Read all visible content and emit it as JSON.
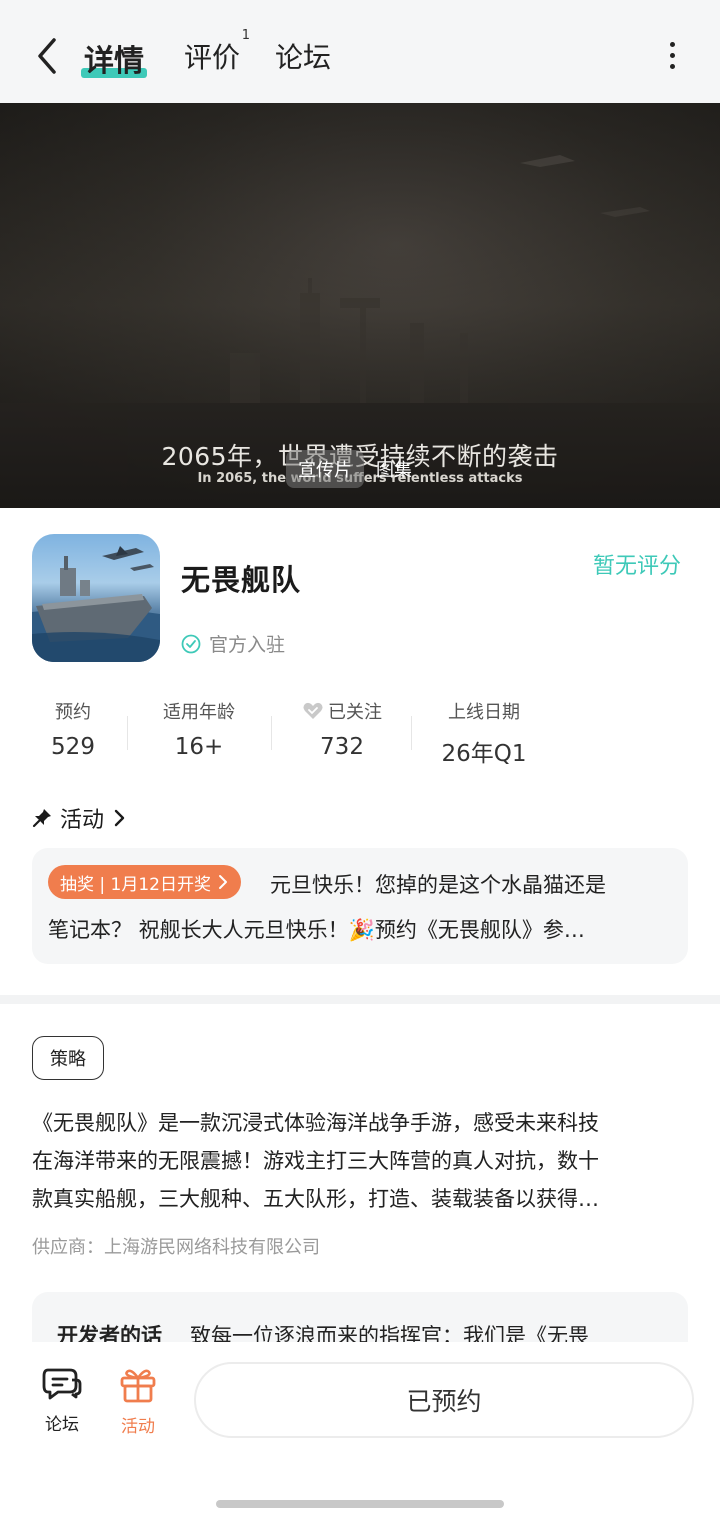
{
  "header": {
    "tabs": [
      {
        "label": "详情"
      },
      {
        "label": "评价",
        "badge": "1"
      },
      {
        "label": "论坛"
      }
    ]
  },
  "video": {
    "subtitle_cn": "2065年，世界遭受持续不断的袭击",
    "subtitle_en": "In 2065, the world suffers relentless attacks",
    "media_tabs": [
      "宣传片",
      "图集"
    ]
  },
  "game": {
    "title": "无畏舰队",
    "official_label": "官方入驻",
    "rating_text": "暂无评分"
  },
  "stats": [
    {
      "label": "预约",
      "value": "529"
    },
    {
      "label": "适用年龄",
      "value": "16+"
    },
    {
      "label": "已关注",
      "value": "732"
    },
    {
      "label": "上线日期",
      "value": "26年Q1"
    }
  ],
  "activity": {
    "heading": "活动",
    "badge": "抽奖 | 1月12日开奖",
    "text_line1": "元旦快乐！您掉的是这个水晶猫还是",
    "text_line2": "笔记本？ 祝舰长大人元旦快乐！🎉预约《无畏舰队》参…"
  },
  "strategy": {
    "tag": "策略",
    "description_lines": [
      "《无畏舰队》是一款沉浸式体验海洋战争手游，感受未来科技",
      "在海洋带来的无限震撼！游戏主打三大阵营的真人对抗，数十",
      "款真实船舰，三大舰种、五大队形，打造、装载装备以获得…"
    ],
    "supplier": "供应商：上海游民网络科技有限公司"
  },
  "developer": {
    "title": "开发者的话",
    "text": "致每一位逐浪而来的指挥官：我们是《无畏"
  },
  "bottom_bar": {
    "forum_label": "论坛",
    "activity_label": "活动",
    "reserve_button": "已预约"
  },
  "colors": {
    "accent": "#3ec9b8",
    "orange": "#f07d4d"
  }
}
